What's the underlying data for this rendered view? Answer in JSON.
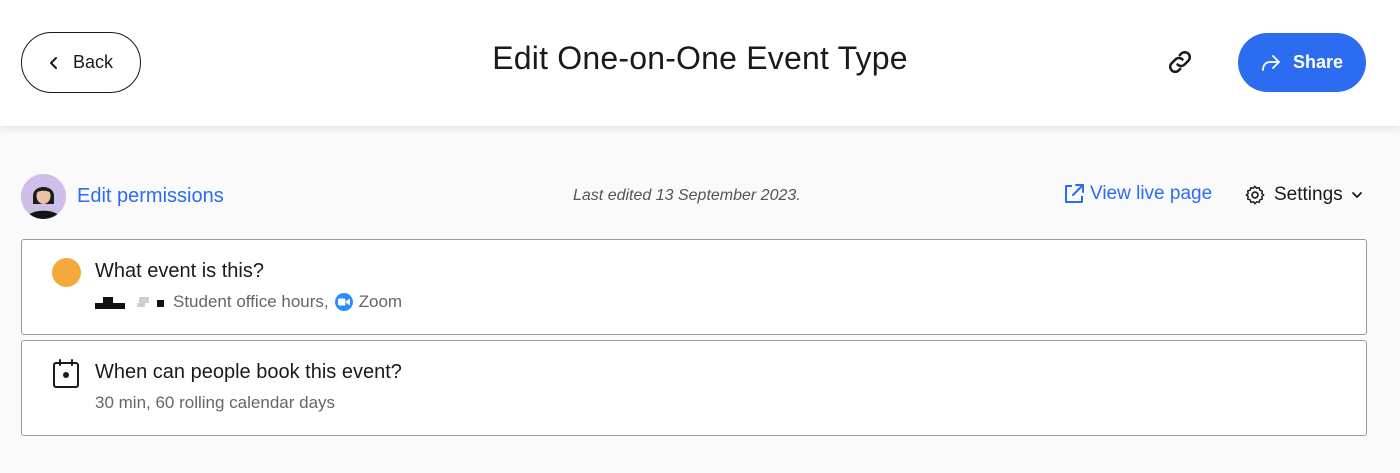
{
  "header": {
    "back_label": "Back",
    "title": "Edit One-on-One Event Type",
    "share_label": "Share"
  },
  "toolbar": {
    "edit_permissions": "Edit permissions",
    "last_edited": "Last edited 13 September 2023.",
    "view_live_page": "View live page",
    "settings": "Settings"
  },
  "cards": [
    {
      "title": "What event is this?",
      "subtitle_text": "Student office hours,",
      "location": "Zoom",
      "color": "#f5a93b"
    },
    {
      "title": "When can people book this event?",
      "subtitle_text": "30 min, 60 rolling calendar days"
    }
  ],
  "colors": {
    "accent": "#2b6cf0",
    "event_color": "#f5a93b",
    "zoom": "#2d8cff"
  },
  "icons": {
    "back": "chevron-left-icon",
    "copy_link": "link-icon",
    "share": "share-arrow-icon",
    "view_live": "external-link-icon",
    "settings": "gear-icon",
    "settings_caret": "chevron-down-icon",
    "calendar": "calendar-icon",
    "zoom": "zoom-icon"
  }
}
